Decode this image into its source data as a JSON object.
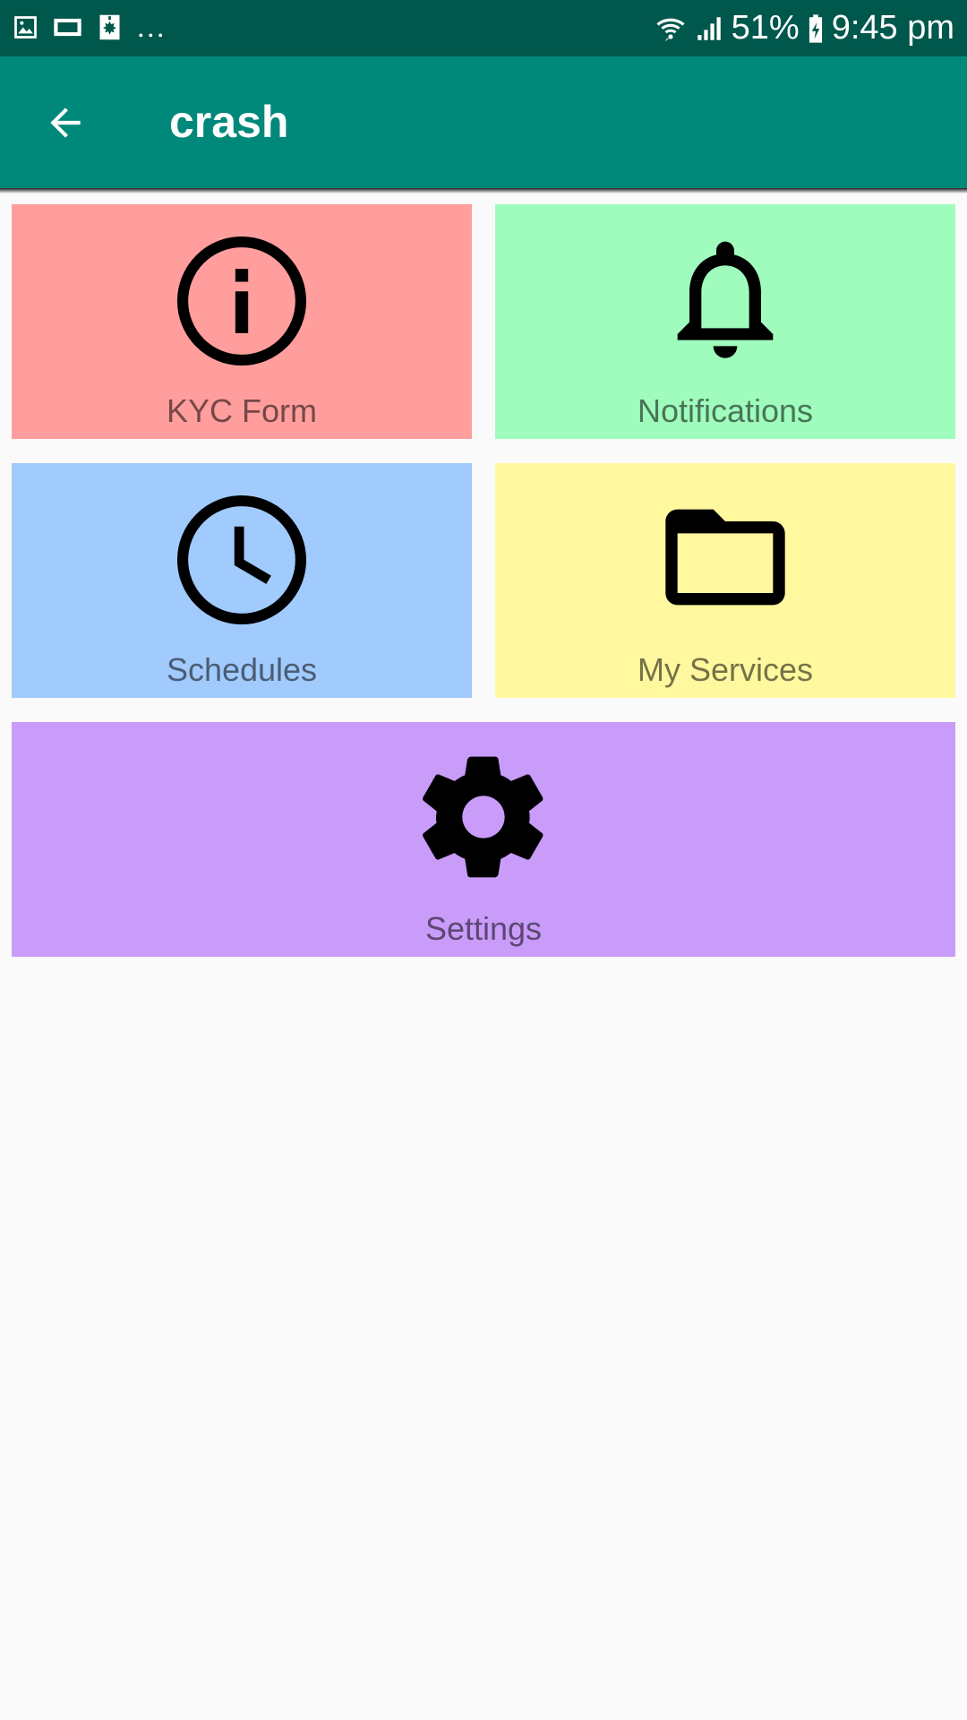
{
  "status_bar": {
    "notification_icons": [
      "image-icon",
      "cast-icon",
      "sim-alert-icon"
    ],
    "more": "...",
    "battery": "51%",
    "time": "9:45 pm"
  },
  "app_bar": {
    "title": "crash",
    "back_icon": "arrow-back-icon",
    "color": "#00897b"
  },
  "tiles": [
    {
      "label": "KYC Form",
      "icon": "info-icon",
      "color": "#ff9e9c"
    },
    {
      "label": "Notifications",
      "icon": "bell-icon",
      "color": "#9ffcbd"
    },
    {
      "label": "Schedules",
      "icon": "clock-icon",
      "color": "#a1cafd"
    },
    {
      "label": "My Services",
      "icon": "folder-icon",
      "color": "#fff89e"
    },
    {
      "label": "Settings",
      "icon": "gear-icon",
      "color": "#c99cfa"
    }
  ]
}
